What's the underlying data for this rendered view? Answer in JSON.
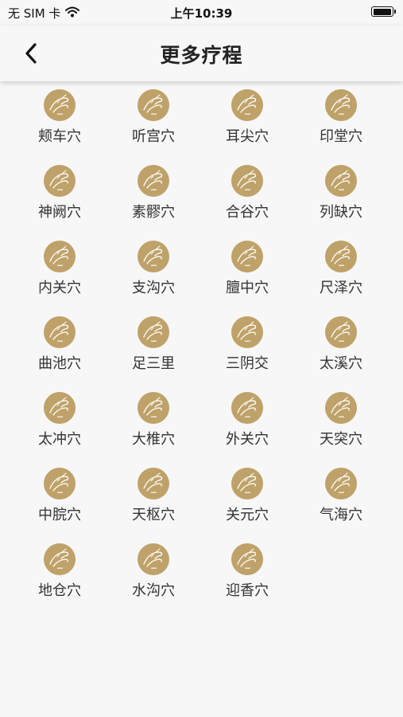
{
  "status": {
    "carrier": "无 SIM 卡",
    "time": "上午10:39"
  },
  "header": {
    "title": "更多疗程"
  },
  "theme": {
    "icon_color": "#bfa269"
  },
  "icon": {
    "name": "hand-massage-icon"
  },
  "acupoints": [
    "颊车穴",
    "听宫穴",
    "耳尖穴",
    "印堂穴",
    "神阙穴",
    "素髎穴",
    "合谷穴",
    "列缺穴",
    "内关穴",
    "支沟穴",
    "膻中穴",
    "尺泽穴",
    "曲池穴",
    "足三里",
    "三阴交",
    "太溪穴",
    "太冲穴",
    "大椎穴",
    "外关穴",
    "天突穴",
    "中脘穴",
    "天枢穴",
    "关元穴",
    "气海穴",
    "地仓穴",
    "水沟穴",
    "迎香穴"
  ]
}
